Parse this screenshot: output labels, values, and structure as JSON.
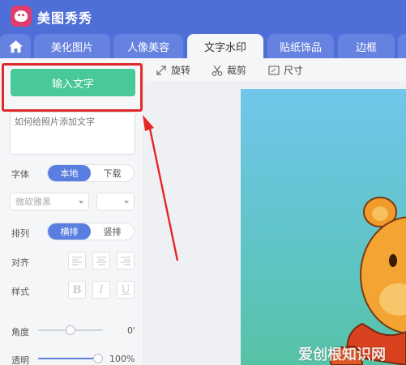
{
  "app": {
    "title": "美图秀秀"
  },
  "tabs": [
    {
      "label": "美化图片"
    },
    {
      "label": "人像美容"
    },
    {
      "label": "文字水印"
    },
    {
      "label": "贴纸饰品"
    },
    {
      "label": "边框"
    }
  ],
  "sidebar": {
    "input_text_button": "输入文字",
    "text_placeholder": "如何给照片添加文字",
    "font": {
      "label": "字体",
      "options": [
        "本地",
        "下载"
      ],
      "selected": "本地"
    },
    "font_name": {
      "value": "微软雅黑"
    },
    "arrange": {
      "label": "排列",
      "options": [
        "横排",
        "竖排"
      ],
      "selected": "横排"
    },
    "align": {
      "label": "对齐"
    },
    "style": {
      "label": "样式",
      "buttons": [
        "B",
        "I",
        "U"
      ]
    },
    "angle": {
      "label": "角度",
      "value": "0'",
      "fraction": 0.5
    },
    "opacity": {
      "label": "透明",
      "value": "100%",
      "fraction": 1.0
    }
  },
  "toolbar": {
    "rotate": "旋转",
    "crop": "裁剪",
    "size": "尺寸"
  },
  "watermark": "爱创根知识网",
  "colors": {
    "header": "#4f6fd8",
    "primary_button": "#48c997",
    "segment_active": "#5a7de0",
    "highlight": "#e02a2a"
  }
}
